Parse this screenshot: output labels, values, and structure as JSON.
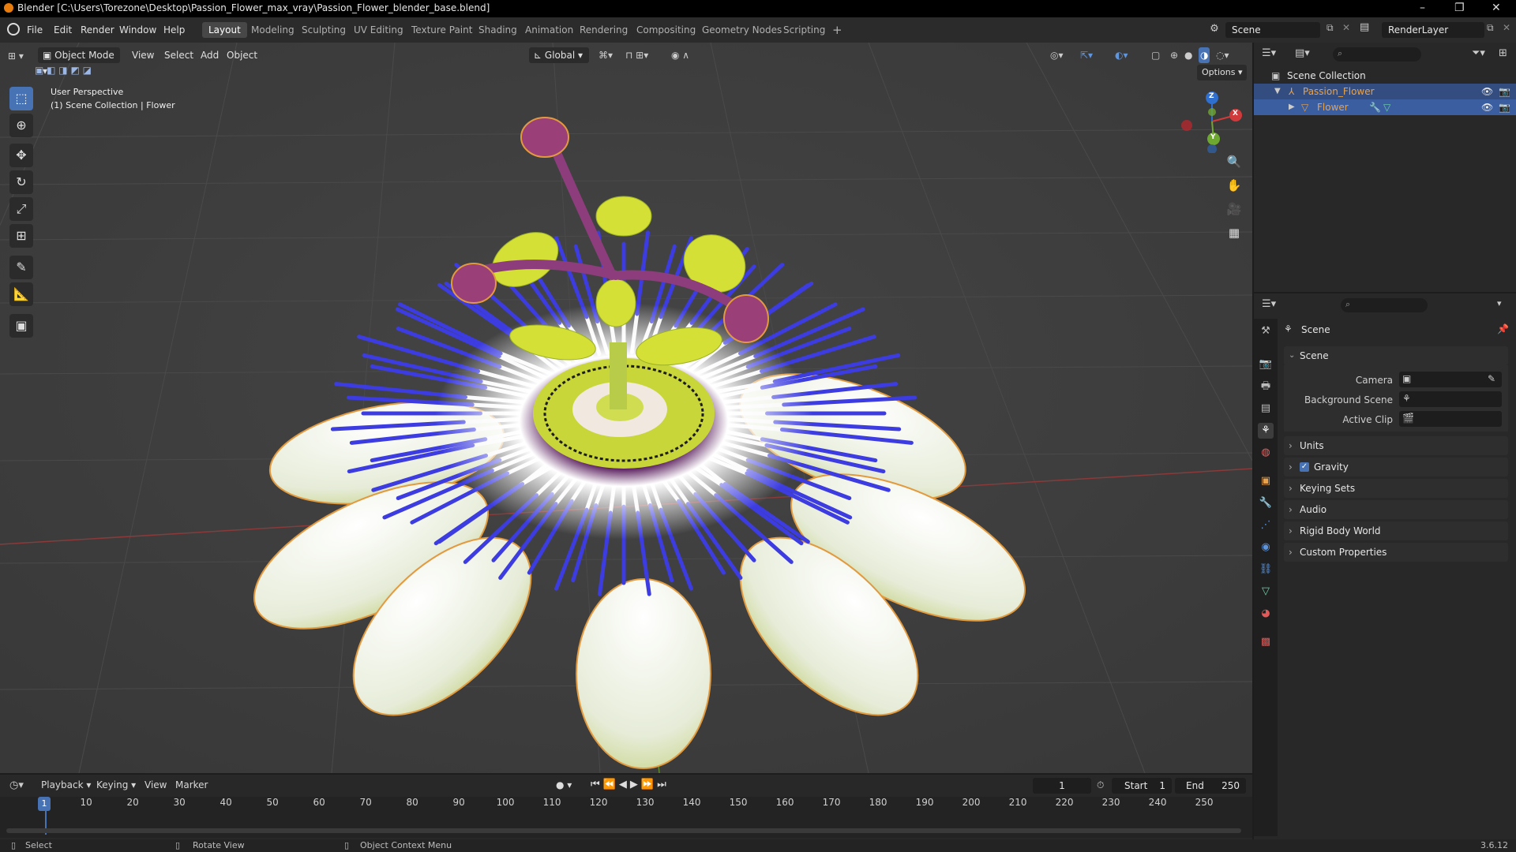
{
  "window": {
    "title": "Blender [C:\\Users\\Torezone\\Desktop\\Passion_Flower_max_vray\\Passion_Flower_blender_base.blend]",
    "controls": [
      "–",
      "❐",
      "✕"
    ]
  },
  "menu": [
    "File",
    "Edit",
    "Render",
    "Window",
    "Help"
  ],
  "workspaces": [
    "Layout",
    "Modeling",
    "Sculpting",
    "UV Editing",
    "Texture Paint",
    "Shading",
    "Animation",
    "Rendering",
    "Compositing",
    "Geometry Nodes",
    "Scripting"
  ],
  "workspace_add": "+",
  "scene_field": "Scene",
  "renderlayer_field": "RenderLayer",
  "viewport": {
    "mode": "Object Mode",
    "menu": [
      "View",
      "Select",
      "Add",
      "Object"
    ],
    "orientation": "Global",
    "options": "Options",
    "overlay_title": "User Perspective",
    "overlay_sub": "(1) Scene Collection | Flower",
    "gizmo_axes": {
      "z": "Z",
      "y": "Y",
      "x": "X"
    }
  },
  "outliner": {
    "root": "Scene Collection",
    "items": [
      "Passion_Flower",
      "Flower"
    ]
  },
  "properties": {
    "header": "Scene",
    "section": "Scene",
    "fields": [
      {
        "label": "Camera"
      },
      {
        "label": "Background Scene"
      },
      {
        "label": "Active Clip"
      }
    ],
    "panels": [
      "Units",
      "Gravity",
      "Keying Sets",
      "Audio",
      "Rigid Body World",
      "Custom Properties"
    ]
  },
  "timeline": {
    "menu": [
      "Playback",
      "Keying",
      "View",
      "Marker"
    ],
    "current_frame": "1",
    "start_label": "Start",
    "start": "1",
    "end_label": "End",
    "end": "250",
    "ticks": [
      "1",
      "10",
      "20",
      "30",
      "40",
      "50",
      "60",
      "70",
      "80",
      "90",
      "100",
      "110",
      "120",
      "130",
      "140",
      "150",
      "160",
      "170",
      "180",
      "190",
      "200",
      "210",
      "220",
      "230",
      "240",
      "250"
    ]
  },
  "status": {
    "select": "Select",
    "rotate": "Rotate View",
    "context": "Object Context Menu",
    "version": "3.6.12"
  },
  "colors": {
    "accent": "#4772b3",
    "selection": "#334d80",
    "object_orange": "#e8a24b",
    "petal_blue": "#3c3ce0",
    "petal_white": "#eef2e6"
  }
}
